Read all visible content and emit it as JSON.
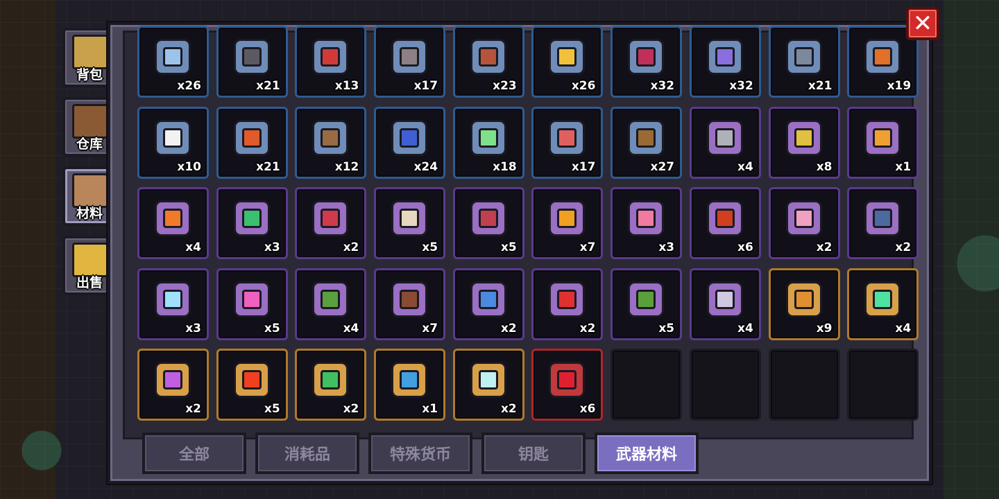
{
  "side_nav": [
    {
      "label": "背包",
      "icon": "backpack-icon",
      "color": "#c9a14a",
      "active": false
    },
    {
      "label": "仓库",
      "icon": "chest-icon",
      "color": "#8a5a34",
      "active": false
    },
    {
      "label": "材料",
      "icon": "materials-book-icon",
      "color": "#b8865a",
      "active": true
    },
    {
      "label": "出售",
      "icon": "gold-coins-icon",
      "color": "#e0b640",
      "active": false
    }
  ],
  "close_label": "✕",
  "tabs": [
    "全部",
    "消耗品",
    "特殊货币",
    "钥匙",
    "武器材料"
  ],
  "active_tab": 4,
  "rarity_colors": {
    "blue": "#2f5b8f",
    "purple": "#5b3a8c",
    "gold": "#b07a2a",
    "red": "#b0262b"
  },
  "items": [
    {
      "qty": "x26",
      "rarity": "blue",
      "icon": "spear-tip-icon",
      "color": "#9ec3ea"
    },
    {
      "qty": "x21",
      "rarity": "blue",
      "icon": "pistol-icon",
      "color": "#5b5a62"
    },
    {
      "qty": "x13",
      "rarity": "blue",
      "icon": "red-dagger-icon",
      "color": "#d23a3a"
    },
    {
      "qty": "x17",
      "rarity": "blue",
      "icon": "pipe-icon",
      "color": "#8c7f86"
    },
    {
      "qty": "x23",
      "rarity": "blue",
      "icon": "rifle-icon",
      "color": "#b5543a"
    },
    {
      "qty": "x26",
      "rarity": "blue",
      "icon": "bullet-icon",
      "color": "#f0c23c"
    },
    {
      "qty": "x32",
      "rarity": "blue",
      "icon": "crimson-blade-icon",
      "color": "#c0305a"
    },
    {
      "qty": "x32",
      "rarity": "blue",
      "icon": "fish-icon",
      "color": "#8a6ee0"
    },
    {
      "qty": "x21",
      "rarity": "blue",
      "icon": "canister-icon",
      "color": "#7a8a9c"
    },
    {
      "qty": "x19",
      "rarity": "blue",
      "icon": "orange-block-icon",
      "color": "#e0702a"
    },
    {
      "qty": "x10",
      "rarity": "blue",
      "icon": "white-blob-icon",
      "color": "#f2f2f2"
    },
    {
      "qty": "x21",
      "rarity": "blue",
      "icon": "lantern-icon",
      "color": "#e05a2a"
    },
    {
      "qty": "x12",
      "rarity": "blue",
      "icon": "leather-scrap-icon",
      "color": "#9a6a44"
    },
    {
      "qty": "x24",
      "rarity": "blue",
      "icon": "blue-gun-icon",
      "color": "#3f5fd4"
    },
    {
      "qty": "x18",
      "rarity": "blue",
      "icon": "green-vial-icon",
      "color": "#7fe08a"
    },
    {
      "qty": "x17",
      "rarity": "blue",
      "icon": "boomerang-icon",
      "color": "#e06060"
    },
    {
      "qty": "x27",
      "rarity": "blue",
      "icon": "wooden-stick-icon",
      "color": "#9a6a34"
    },
    {
      "qty": "x4",
      "rarity": "purple",
      "icon": "gear-disc-icon",
      "color": "#b0b0b8"
    },
    {
      "qty": "x8",
      "rarity": "purple",
      "icon": "golden-bell-icon",
      "color": "#e0c040"
    },
    {
      "qty": "x1",
      "rarity": "purple",
      "icon": "golden-ring-icon",
      "color": "#f0a030"
    },
    {
      "qty": "x4",
      "rarity": "purple",
      "icon": "orange-ring-icon",
      "color": "#f07a2a"
    },
    {
      "qty": "x3",
      "rarity": "purple",
      "icon": "green-orb-icon",
      "color": "#3ac070"
    },
    {
      "qty": "x2",
      "rarity": "purple",
      "icon": "whip-icon",
      "color": "#d03a4a"
    },
    {
      "qty": "x5",
      "rarity": "purple",
      "icon": "horn-icon",
      "color": "#e8d8c0"
    },
    {
      "qty": "x5",
      "rarity": "purple",
      "icon": "shield-badge-icon",
      "color": "#c04050"
    },
    {
      "qty": "x7",
      "rarity": "purple",
      "icon": "lamp-core-icon",
      "color": "#f0a020"
    },
    {
      "qty": "x3",
      "rarity": "purple",
      "icon": "pink-crystal-icon",
      "color": "#f07aa0"
    },
    {
      "qty": "x6",
      "rarity": "purple",
      "icon": "magma-bowl-icon",
      "color": "#d04020"
    },
    {
      "qty": "x2",
      "rarity": "purple",
      "icon": "magic-wand-icon",
      "color": "#f0a0c0"
    },
    {
      "qty": "x2",
      "rarity": "purple",
      "icon": "blue-jar-icon",
      "color": "#4a6aa0"
    },
    {
      "qty": "x3",
      "rarity": "purple",
      "icon": "ice-lance-icon",
      "color": "#a0e0ff"
    },
    {
      "qty": "x5",
      "rarity": "purple",
      "icon": "pink-flower-icon",
      "color": "#f060c0"
    },
    {
      "qty": "x4",
      "rarity": "purple",
      "icon": "green-cannon-icon",
      "color": "#5aa040"
    },
    {
      "qty": "x7",
      "rarity": "purple",
      "icon": "brown-crossbow-icon",
      "color": "#8a4a34"
    },
    {
      "qty": "x2",
      "rarity": "purple",
      "icon": "blue-syringe-icon",
      "color": "#4a8ae0"
    },
    {
      "qty": "x2",
      "rarity": "purple",
      "icon": "extinguisher-icon",
      "color": "#e03030"
    },
    {
      "qty": "x5",
      "rarity": "purple",
      "icon": "cactus-icon",
      "color": "#5aa03a"
    },
    {
      "qty": "x4",
      "rarity": "purple",
      "icon": "silver-helm-icon",
      "color": "#d0c8e0"
    },
    {
      "qty": "x9",
      "rarity": "gold",
      "icon": "gold-crossbow-icon",
      "color": "#e09030"
    },
    {
      "qty": "x4",
      "rarity": "gold",
      "icon": "green-star-icon",
      "color": "#50e0a0"
    },
    {
      "qty": "x2",
      "rarity": "gold",
      "icon": "pickaxe-icon",
      "color": "#c060e0"
    },
    {
      "qty": "x5",
      "rarity": "gold",
      "icon": "fire-gem-icon",
      "color": "#f04020"
    },
    {
      "qty": "x2",
      "rarity": "gold",
      "icon": "green-scroll-icon",
      "color": "#40c060"
    },
    {
      "qty": "x1",
      "rarity": "gold",
      "icon": "blue-beast-icon",
      "color": "#40a0e0"
    },
    {
      "qty": "x2",
      "rarity": "gold",
      "icon": "ghost-jaw-icon",
      "color": "#c0f0f0"
    },
    {
      "qty": "x6",
      "rarity": "red",
      "icon": "red-flower-icon",
      "color": "#e02030"
    },
    {
      "qty": "",
      "rarity": "empty",
      "icon": "",
      "color": ""
    },
    {
      "qty": "",
      "rarity": "empty",
      "icon": "",
      "color": ""
    },
    {
      "qty": "",
      "rarity": "empty",
      "icon": "",
      "color": ""
    },
    {
      "qty": "",
      "rarity": "empty",
      "icon": "",
      "color": ""
    }
  ]
}
